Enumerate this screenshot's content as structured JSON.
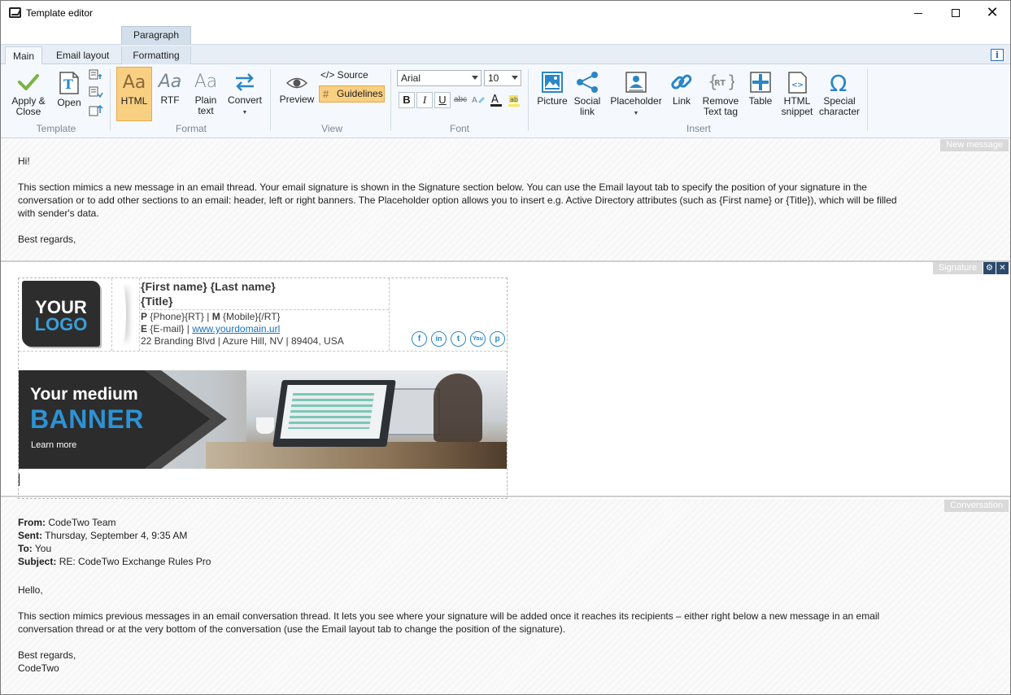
{
  "window": {
    "title": "Template editor",
    "controls": {
      "minimize": "",
      "maximize": "",
      "close": "✕"
    }
  },
  "ribbon": {
    "context_group": "Paragraph",
    "tabs": [
      "Main",
      "Email layout",
      "Formatting"
    ],
    "active_tab": "Main",
    "info_label": "i",
    "groups": {
      "template": {
        "label": "Template",
        "apply": "Apply &",
        "apply2": "Close",
        "open": "Open"
      },
      "format": {
        "label": "Format",
        "html": "HTML",
        "rtf": "RTF",
        "plain": "Plain",
        "plain2": "text",
        "convert": "Convert",
        "aa": "Aa",
        "selected": "HTML"
      },
      "view": {
        "label": "View",
        "preview": "Preview",
        "source": "</> Source",
        "guidelines": "Guidelines"
      },
      "font": {
        "label": "Font",
        "font_name": "Arial",
        "font_size": "10",
        "bold": "B",
        "italic": "I",
        "underline": "U",
        "strike": "abc"
      },
      "insert": {
        "label": "Insert",
        "picture": "Picture",
        "social": "Social",
        "social2": "link",
        "placeholder": "Placeholder",
        "link": "Link",
        "remove": "Remove",
        "remove2": "Text tag",
        "table": "Table",
        "snippet": "HTML",
        "snippet2": "snippet",
        "special": "Special",
        "special2": "character"
      }
    }
  },
  "sections": {
    "new_message": {
      "tag": "New message",
      "greeting": "Hi!",
      "body_line1": "This section mimics a new message in an email thread. Your email signature is shown in the Signature section below. You can use the Email layout tab to specify the position of your signature in the",
      "body_line2": "conversation or to add other sections to an email: header, left or right banners. The Placeholder option allows you to insert e.g. Active Directory attributes (such as {First name} or {Title}), which will be filled",
      "body_line3": "with sender's data.",
      "closing": "Best regards,"
    },
    "signature": {
      "tag": "Signature",
      "logo_line1": "YOUR",
      "logo_line2": "LOGO",
      "name": "{First name} {Last name}",
      "title": "{Title}",
      "phone_label": "P",
      "phone": "{Phone}{RT}",
      "sep1": "|",
      "mobile_label": "M",
      "mobile": "{Mobile}{/RT}",
      "email_label": "E",
      "email": "{E-mail}",
      "sep2": "|",
      "website": "www.yourdomain.url",
      "address": "22 Branding Blvd | Azure Hill, NV | 89404, USA",
      "social_icons": [
        "f",
        "in",
        "t",
        "You",
        "p"
      ],
      "banner_line1": "Your medium",
      "banner_line2": "BANNER",
      "banner_line3": "Learn more"
    },
    "conversation": {
      "tag": "Conversation",
      "from_label": "From:",
      "from": "CodeTwo Team",
      "sent_label": "Sent:",
      "sent": "Thursday, September 4, 9:35 AM",
      "to_label": "To:",
      "to": "You",
      "subject_label": "Subject:",
      "subject": "RE: CodeTwo Exchange Rules Pro",
      "greeting": "Hello,",
      "body_line1": "This section mimics previous messages in an email conversation thread. It lets you see where your signature will be added once it reaches its recipients – either right below a new message in an email",
      "body_line2": "conversation thread or at the very bottom of the conversation (use the Email layout tab to change the position of the signature).",
      "closing": "Best regards,",
      "signoff": "CodeTwo"
    }
  },
  "colors": {
    "accent_blue": "#2a86c6",
    "active_button": "#f9cf82",
    "check_green": "#7cb342",
    "banner_blue": "#2d92d4"
  }
}
